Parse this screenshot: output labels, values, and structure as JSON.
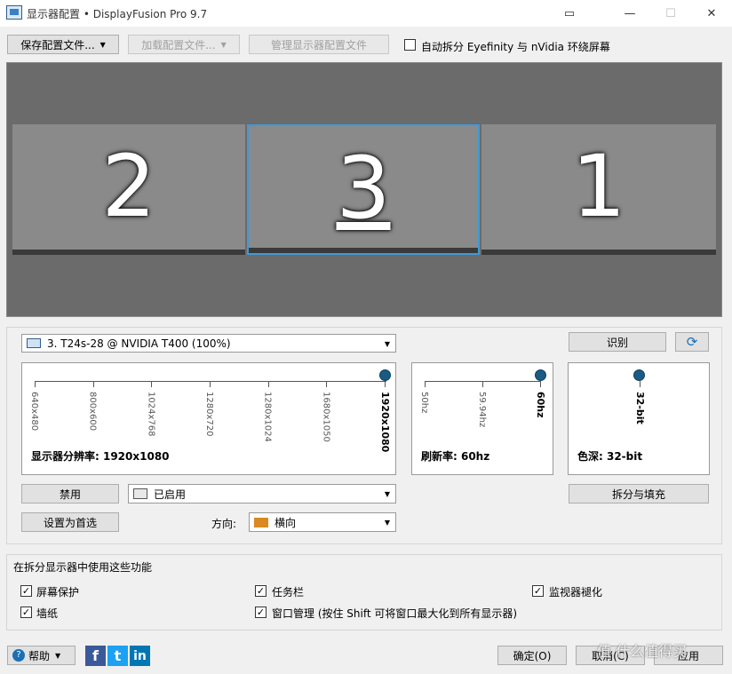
{
  "window": {
    "title": "显示器配置 • DisplayFusion Pro 9.7",
    "controls": {
      "restore": "▭",
      "minimize": "—",
      "maximize": "☐",
      "close": "✕"
    }
  },
  "toolbar": {
    "save_profile": "保存配置文件...",
    "load_profile": "加载配置文件...",
    "manage_profiles": "管理显示器配置文件",
    "auto_split_label": "自动拆分 Eyefinity 与 nVidia 环绕屏幕",
    "auto_split_checked": false
  },
  "preview": {
    "monitors": [
      {
        "number": "2",
        "selected": false
      },
      {
        "number": "3",
        "selected": true
      },
      {
        "number": "1",
        "selected": false
      }
    ]
  },
  "monitor_select": {
    "value": "3. T24s-28 @ NVIDIA T400 (100%)",
    "identify_label": "识别",
    "refresh_icon": "refresh-icon"
  },
  "resolution": {
    "ticks": [
      "640x480",
      "800x600",
      "1024x768",
      "1280x720",
      "1280x1024",
      "1680x1050",
      "1920x1080"
    ],
    "selected": "1920x1080",
    "caption": "显示器分辨率: 1920x1080"
  },
  "refresh_rate": {
    "ticks": [
      "50hz",
      "59.94hz",
      "60hz"
    ],
    "selected": "60hz",
    "caption": "刷新率: 60hz"
  },
  "color_depth": {
    "ticks": [
      "32-bit"
    ],
    "selected": "32-bit",
    "caption": "色深: 32-bit"
  },
  "monitor_controls": {
    "disable_label": "禁用",
    "state_value": "已启用",
    "set_primary_label": "设置为首选",
    "orientation_label": "方向:",
    "orientation_value": "横向",
    "split_fill_label": "拆分与填充"
  },
  "split_features": {
    "heading": "在拆分显示器中使用这些功能",
    "items": [
      {
        "label": "屏幕保护",
        "checked": true
      },
      {
        "label": "任务栏",
        "checked": true
      },
      {
        "label": "监视器褪化",
        "checked": true
      },
      {
        "label": "墙纸",
        "checked": true
      },
      {
        "label": "窗口管理 (按住 Shift 可将窗口最大化到所有显示器)",
        "checked": true
      }
    ]
  },
  "footer": {
    "help_label": "帮助",
    "social": [
      "f",
      "t",
      "in"
    ],
    "ok_label": "确定(O)",
    "cancel_label": "取消(C)",
    "apply_label": "应用",
    "watermark": "值 什么值得买"
  },
  "colors": {
    "accent": "#1a5b86",
    "facebook": "#3b5998",
    "twitter": "#1da1f2",
    "linkedin": "#0077b5"
  }
}
